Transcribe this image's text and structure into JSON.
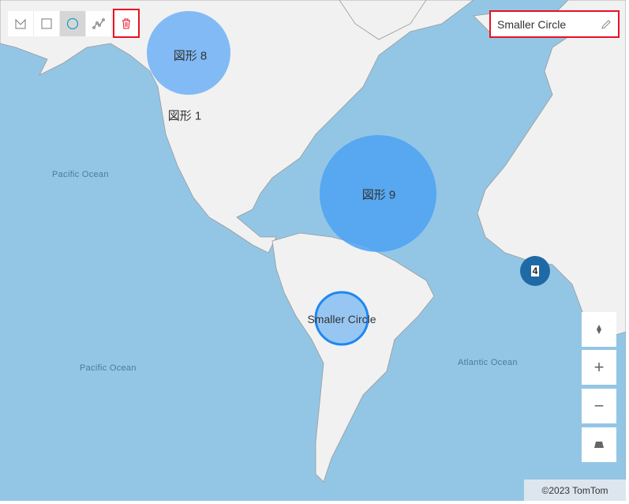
{
  "toolbar": {
    "tools": [
      {
        "name": "draw-polygon",
        "icon": "polygon-icon"
      },
      {
        "name": "draw-rectangle",
        "icon": "square-icon"
      },
      {
        "name": "draw-circle",
        "icon": "circle-icon",
        "active": true
      },
      {
        "name": "draw-line",
        "icon": "line-icon"
      }
    ],
    "delete_icon": "trash-icon"
  },
  "name_box": {
    "value": "Smaller Circle",
    "icon": "pencil-icon"
  },
  "ocean_labels": {
    "pacific_north": "Pacific Ocean",
    "pacific_south": "Pacific Ocean",
    "atlantic": "Atlantic Ocean"
  },
  "shapes": {
    "shape8": "図形 8",
    "shape1": "図形 1",
    "shape9": "図形 9",
    "smaller": "Smaller Circle"
  },
  "cluster": {
    "count": "4"
  },
  "controls": {
    "compass": "compass-icon",
    "zoom_in": "+",
    "zoom_out": "−",
    "pitch": "pitch-icon"
  },
  "attribution": "©2023 TomTom",
  "colors": {
    "ocean": "#93c6e5",
    "land": "#f1f1f1",
    "circle_fill": "#5aa9f5",
    "cluster": "#1f6aa5",
    "highlight": "#e81123"
  }
}
